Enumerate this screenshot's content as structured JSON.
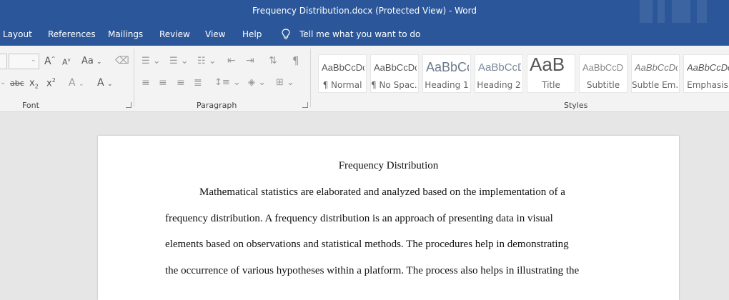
{
  "window": {
    "title": "Frequency Distribution.docx (Protected View)  -  Word"
  },
  "menu": {
    "items": [
      "Layout",
      "References",
      "Mailings",
      "Review",
      "View",
      "Help"
    ],
    "tell_me": "Tell me what you want to do"
  },
  "ribbon": {
    "groups": {
      "font": "Font",
      "paragraph": "Paragraph",
      "styles": "Styles"
    },
    "font_controls": {
      "grow": "A",
      "shrink": "A",
      "case": "Aa",
      "strike": "abc",
      "sub": "x",
      "sub_mark": "2",
      "sup": "x",
      "sup_mark": "2",
      "effects": "A",
      "color": "A"
    },
    "paragraph_controls": {
      "pilcrow": "¶"
    },
    "styles": [
      {
        "sample": "AaBbCcDc",
        "name": "¶ Normal"
      },
      {
        "sample": "AaBbCcDc",
        "name": "¶ No Spac..."
      },
      {
        "sample": "AaBbCc",
        "name": "Heading 1"
      },
      {
        "sample": "AaBbCcD",
        "name": "Heading 2"
      },
      {
        "sample": "AaB",
        "name": "Title"
      },
      {
        "sample": "AaBbCcD",
        "name": "Subtitle"
      },
      {
        "sample": "AaBbCcDc",
        "name": "Subtle Em..."
      },
      {
        "sample": "AaBbCcDc",
        "name": "Emphasis"
      }
    ]
  },
  "document": {
    "title": "Frequency Distribution",
    "lines": [
      "Mathematical statistics are elaborated and analyzed based on the implementation of a",
      "frequency distribution. A frequency distribution is an approach of presenting data in visual",
      "elements based on observations and statistical methods. The procedures help in demonstrating",
      "the occurrence of various hypotheses within a platform. The process also helps in illustrating the"
    ]
  },
  "colors": {
    "accent": "#2b579a",
    "ribbon": "#f3f3f3",
    "canvas": "#e6e6e6"
  }
}
